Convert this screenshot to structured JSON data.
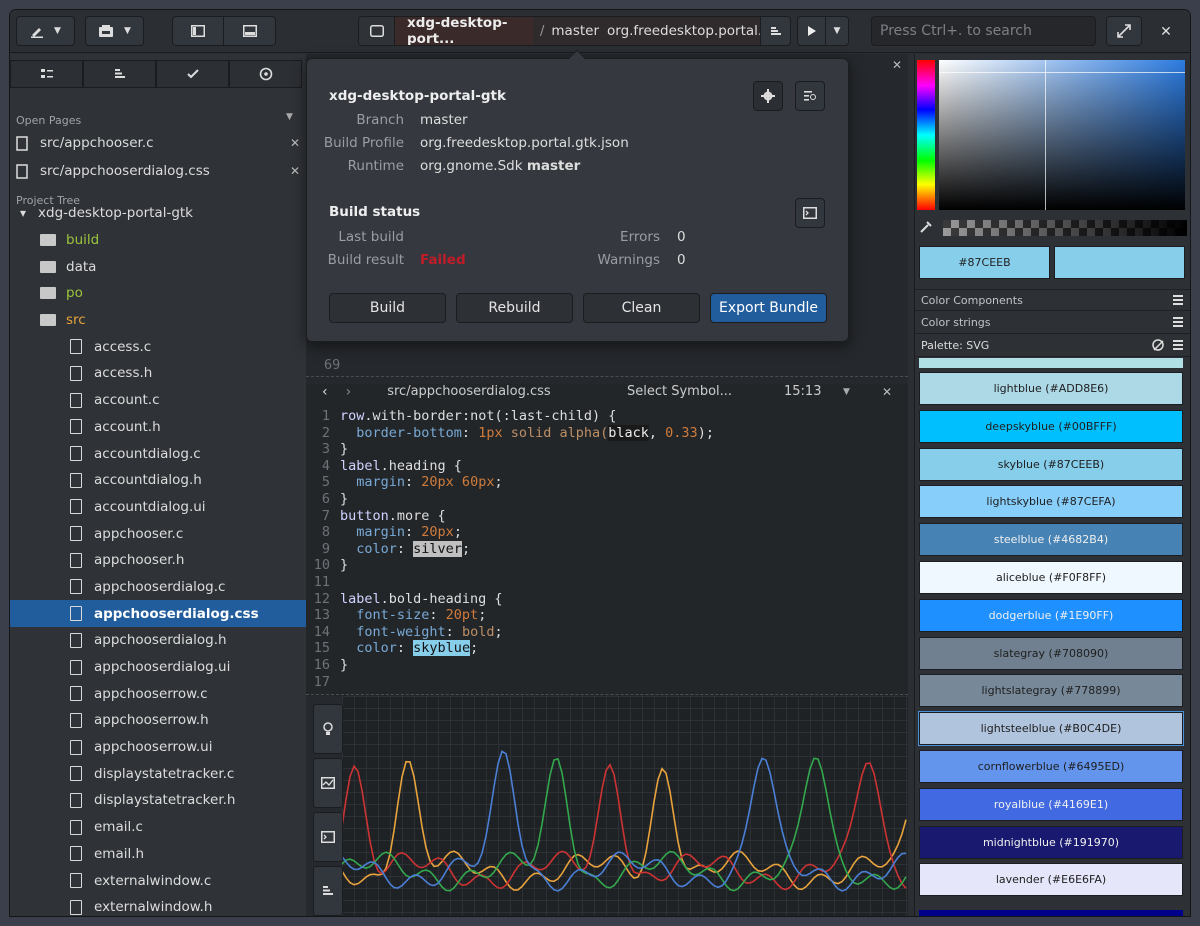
{
  "headerbar": {
    "build_project": "xdg-desktop-port...",
    "build_branch": "master",
    "build_profile": "org.freedesktop.portal.g...",
    "search_placeholder": "Press Ctrl+. to search"
  },
  "sidebar": {
    "open_pages_title": "Open Pages",
    "open_pages": [
      "src/appchooser.c",
      "src/appchooserdialog.css"
    ],
    "project_tree_title": "Project Tree",
    "tree": [
      {
        "name": "xdg-desktop-portal-gtk",
        "kind": "root",
        "depth": 0
      },
      {
        "name": "build",
        "kind": "folder",
        "depth": 1,
        "color": "#9bc53d"
      },
      {
        "name": "data",
        "kind": "folder",
        "depth": 1,
        "color": "#dcdcdc"
      },
      {
        "name": "po",
        "kind": "folder",
        "depth": 1,
        "color": "#9bc53d"
      },
      {
        "name": "src",
        "kind": "folder",
        "depth": 1,
        "color": "#e8a33d"
      },
      {
        "name": "access.c",
        "kind": "file",
        "depth": 2
      },
      {
        "name": "access.h",
        "kind": "file",
        "depth": 2
      },
      {
        "name": "account.c",
        "kind": "file",
        "depth": 2
      },
      {
        "name": "account.h",
        "kind": "file",
        "depth": 2
      },
      {
        "name": "accountdialog.c",
        "kind": "file",
        "depth": 2
      },
      {
        "name": "accountdialog.h",
        "kind": "file",
        "depth": 2
      },
      {
        "name": "accountdialog.ui",
        "kind": "file",
        "depth": 2
      },
      {
        "name": "appchooser.c",
        "kind": "file",
        "depth": 2
      },
      {
        "name": "appchooser.h",
        "kind": "file",
        "depth": 2
      },
      {
        "name": "appchooserdialog.c",
        "kind": "file",
        "depth": 2
      },
      {
        "name": "appchooserdialog.css",
        "kind": "file",
        "depth": 2,
        "selected": true
      },
      {
        "name": "appchooserdialog.h",
        "kind": "file",
        "depth": 2
      },
      {
        "name": "appchooserdialog.ui",
        "kind": "file",
        "depth": 2
      },
      {
        "name": "appchooserrow.c",
        "kind": "file",
        "depth": 2
      },
      {
        "name": "appchooserrow.h",
        "kind": "file",
        "depth": 2
      },
      {
        "name": "appchooserrow.ui",
        "kind": "file",
        "depth": 2
      },
      {
        "name": "displaystatetracker.c",
        "kind": "file",
        "depth": 2
      },
      {
        "name": "displaystatetracker.h",
        "kind": "file",
        "depth": 2
      },
      {
        "name": "email.c",
        "kind": "file",
        "depth": 2
      },
      {
        "name": "email.h",
        "kind": "file",
        "depth": 2
      },
      {
        "name": "externalwindow.c",
        "kind": "file",
        "depth": 2
      },
      {
        "name": "externalwindow.h",
        "kind": "file",
        "depth": 2
      }
    ]
  },
  "popover": {
    "title": "xdg-desktop-portal-gtk",
    "branch_label": "Branch",
    "branch_value": "master",
    "profile_label": "Build Profile",
    "profile_value": "org.freedesktop.portal.gtk.json",
    "runtime_label": "Runtime",
    "runtime_value": "org.gnome.Sdk",
    "runtime_bold": "master",
    "status_title": "Build status",
    "last_build_label": "Last build",
    "last_build_value": "",
    "result_label": "Build result",
    "result_value": "Failed",
    "errors_label": "Errors",
    "errors_value": "0",
    "warnings_label": "Warnings",
    "warnings_value": "0",
    "buttons": [
      "Build",
      "Rebuild",
      "Clean",
      "Export Bundle"
    ]
  },
  "editor": {
    "upper_line": "69",
    "file_path": "src/appchooserdialog.css",
    "symbol": "Select Symbol...",
    "position": "15:13",
    "lines": [
      [
        [
          "row",
          "sel-c"
        ],
        [
          ".with-border",
          ""
        ],
        [
          ":not(",
          ""
        ],
        [
          ":last-child",
          ""
        ],
        [
          ") {",
          ""
        ]
      ],
      [
        [
          "  border-bottom",
          "prop-c"
        ],
        [
          ": ",
          ""
        ],
        [
          "1px",
          "num"
        ],
        [
          " solid ",
          "kw"
        ],
        [
          "alpha(",
          "kw"
        ],
        [
          "black",
          "hl-d"
        ],
        [
          ", ",
          ""
        ],
        [
          "0.33",
          "num"
        ],
        [
          ");",
          ""
        ]
      ],
      [
        [
          "}",
          ""
        ]
      ],
      [
        [
          "label",
          "sel-c"
        ],
        [
          ".heading {",
          ""
        ]
      ],
      [
        [
          "  margin",
          "prop-c"
        ],
        [
          ": ",
          ""
        ],
        [
          "20px 60px",
          "num"
        ],
        [
          ";",
          ""
        ]
      ],
      [
        [
          "}",
          ""
        ]
      ],
      [
        [
          "button",
          "sel-c"
        ],
        [
          ".more {",
          ""
        ]
      ],
      [
        [
          "  margin",
          "prop-c"
        ],
        [
          ": ",
          ""
        ],
        [
          "20px",
          "num"
        ],
        [
          ";",
          ""
        ]
      ],
      [
        [
          "  color",
          "prop-c"
        ],
        [
          ": ",
          ""
        ],
        [
          "silver",
          "hl-s"
        ],
        [
          ";",
          ""
        ]
      ],
      [
        [
          "}",
          ""
        ]
      ],
      [
        [
          "",
          ""
        ]
      ],
      [
        [
          "label",
          "sel-c"
        ],
        [
          ".bold-heading {",
          ""
        ]
      ],
      [
        [
          "  font-size",
          "prop-c"
        ],
        [
          ": ",
          ""
        ],
        [
          "20pt",
          "num"
        ],
        [
          ";",
          ""
        ]
      ],
      [
        [
          "  font-weight",
          "prop-c"
        ],
        [
          ": ",
          ""
        ],
        [
          "bold",
          "kw"
        ],
        [
          ";",
          ""
        ]
      ],
      [
        [
          "  color",
          "prop-c"
        ],
        [
          ": ",
          ""
        ],
        [
          "skyblue",
          "hl-b"
        ],
        [
          ";",
          ""
        ]
      ],
      [
        [
          "}",
          ""
        ]
      ],
      [
        [
          "",
          ""
        ]
      ]
    ]
  },
  "color_panel": {
    "hex_value": "#87CEEB",
    "color_components": "Color Components",
    "color_strings": "Color strings",
    "palette": "Palette: SVG",
    "swatches": [
      {
        "label": "lightblue (#ADD8E6)",
        "color": "#ADD8E6",
        "text": "#1e1e1e"
      },
      {
        "label": "deepskyblue (#00BFFF)",
        "color": "#00BFFF",
        "text": "#1e1e1e"
      },
      {
        "label": "skyblue (#87CEEB)",
        "color": "#87CEEB",
        "text": "#1e1e1e"
      },
      {
        "label": "lightskyblue (#87CEFA)",
        "color": "#87CEFA",
        "text": "#1e1e1e"
      },
      {
        "label": "steelblue (#4682B4)",
        "color": "#4682B4",
        "text": "#f0f0f0"
      },
      {
        "label": "aliceblue (#F0F8FF)",
        "color": "#F0F8FF",
        "text": "#1e1e1e"
      },
      {
        "label": "dodgerblue (#1E90FF)",
        "color": "#1E90FF",
        "text": "#f0f0f0"
      },
      {
        "label": "slategray (#708090)",
        "color": "#708090",
        "text": "#1e1e1e"
      },
      {
        "label": "lightslategray (#778899)",
        "color": "#778899",
        "text": "#1e1e1e"
      },
      {
        "label": "lightsteelblue (#B0C4DE)",
        "color": "#B0C4DE",
        "text": "#1e1e1e"
      },
      {
        "label": "cornflowerblue (#6495ED)",
        "color": "#6495ED",
        "text": "#1e1e1e"
      },
      {
        "label": "royalblue (#4169E1)",
        "color": "#4169E1",
        "text": "#f0f0f0"
      },
      {
        "label": "midnightblue (#191970)",
        "color": "#191970",
        "text": "#f0f0f0"
      },
      {
        "label": "lavender (#E6E6FA)",
        "color": "#E6E6FA",
        "text": "#1e1e1e"
      }
    ]
  }
}
